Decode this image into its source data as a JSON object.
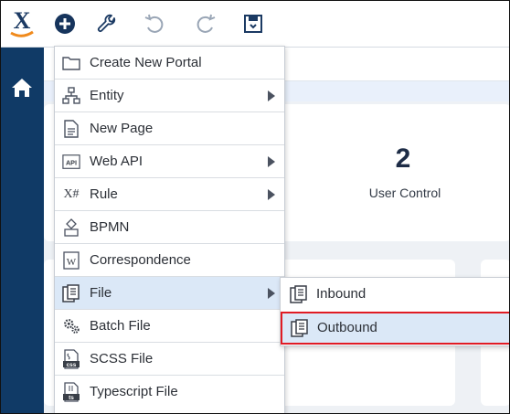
{
  "toolbar": {
    "logo": "X",
    "icons": [
      "add-circle-icon",
      "wrench-icon",
      "undo-icon",
      "redo-icon",
      "save-icon"
    ]
  },
  "sidenav": {
    "home_icon": "home-icon"
  },
  "dashboard": {
    "stat_value": "2",
    "stat_label": "User Control"
  },
  "menu": {
    "items": [
      {
        "label": "Create New Portal",
        "icon": "folder-icon",
        "submenu": false
      },
      {
        "label": "Entity",
        "icon": "hierarchy-icon",
        "submenu": true
      },
      {
        "label": "New Page",
        "icon": "page-icon",
        "submenu": false
      },
      {
        "label": "Web API",
        "icon": "api-icon",
        "icon_text": "API",
        "submenu": true
      },
      {
        "label": "Rule",
        "icon": "rule-icon",
        "icon_text": "X#",
        "submenu": true
      },
      {
        "label": "BPMN",
        "icon": "bpmn-icon",
        "submenu": false
      },
      {
        "label": "Correspondence",
        "icon": "correspondence-icon",
        "icon_text": "W",
        "submenu": false
      },
      {
        "label": "File",
        "icon": "file-icon",
        "submenu": true,
        "active": true
      },
      {
        "label": "Batch File",
        "icon": "gears-icon",
        "submenu": false
      },
      {
        "label": "SCSS File",
        "icon": "scss-file-icon",
        "icon_text": "css",
        "submenu": false
      },
      {
        "label": "Typescript File",
        "icon": "ts-file-icon",
        "icon_text": "ts",
        "submenu": false
      }
    ]
  },
  "submenu": {
    "items": [
      {
        "label": "Inbound",
        "icon": "file-icon"
      },
      {
        "label": "Outbound",
        "icon": "file-icon",
        "highlighted": true
      }
    ]
  },
  "colors": {
    "sidenav": "#103a66",
    "accent": "#1f5fa8",
    "active_bg": "#dbe8f7",
    "highlight_border": "#e01b24"
  }
}
